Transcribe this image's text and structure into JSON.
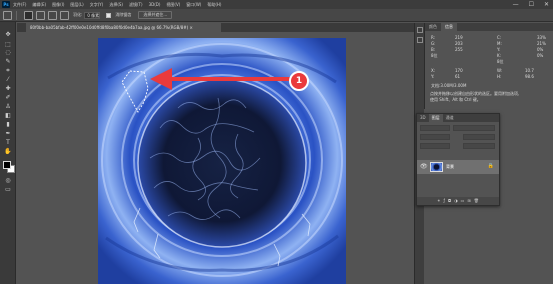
{
  "app": {
    "logo": "Ps"
  },
  "menu": [
    "文件(F)",
    "编辑(E)",
    "图像(I)",
    "图层(L)",
    "文字(Y)",
    "选择(S)",
    "滤镜(T)",
    "3D(D)",
    "视图(V)",
    "窗口(W)",
    "帮助(H)"
  ],
  "window_controls": {
    "minimize": "—",
    "maximize": "☐",
    "close": "✕"
  },
  "options_bar": {
    "feather_label": "羽化:",
    "feather_value": "0 像素",
    "antialias_label": "消除锯齿",
    "select_mask_label": "选择并遮住..."
  },
  "document": {
    "tab_title": "80f0bb-ba05bfab-42ff00e0e10d0ffd8f0ba80f0d0e4b7aa.jpg @ 66.7%(RGB/8#) ×"
  },
  "info_panel": {
    "tabs": [
      "颜色",
      "信息"
    ],
    "r_label": "R:",
    "r_value": "219",
    "g_label": "G:",
    "g_value": "203",
    "b_label": "B:",
    "b_value": "255",
    "c_label": "C:",
    "c_value": "33%",
    "m_label": "M:",
    "m_value": "21%",
    "y_label": "Y:",
    "y_value": "0%",
    "k_label": "K:",
    "k_value": "0%",
    "bit_left": "8位",
    "bit_right": "8位",
    "x_label": "X:",
    "x_value": "170",
    "y_pos_label": "Y:",
    "y_pos_value": "61",
    "w_label": "W:",
    "w_value": "10.7",
    "h_label": "H:",
    "h_value": "98.6",
    "doc_size": "文档:3.00M/3.00M",
    "hint_line1": "点按并拖移以创建自由形状的选区。要用附加选项,",
    "hint_line2": "使用 Shift、Alt 和 Ctrl 键。"
  },
  "layers_panel": {
    "tabs": [
      "3D",
      "图层",
      "通道"
    ],
    "layer_name": "背景",
    "lock_icon": "🔒",
    "eye_icon": "👁"
  },
  "annotation": {
    "number": "1",
    "arrow_color": "#ea3a3c"
  }
}
